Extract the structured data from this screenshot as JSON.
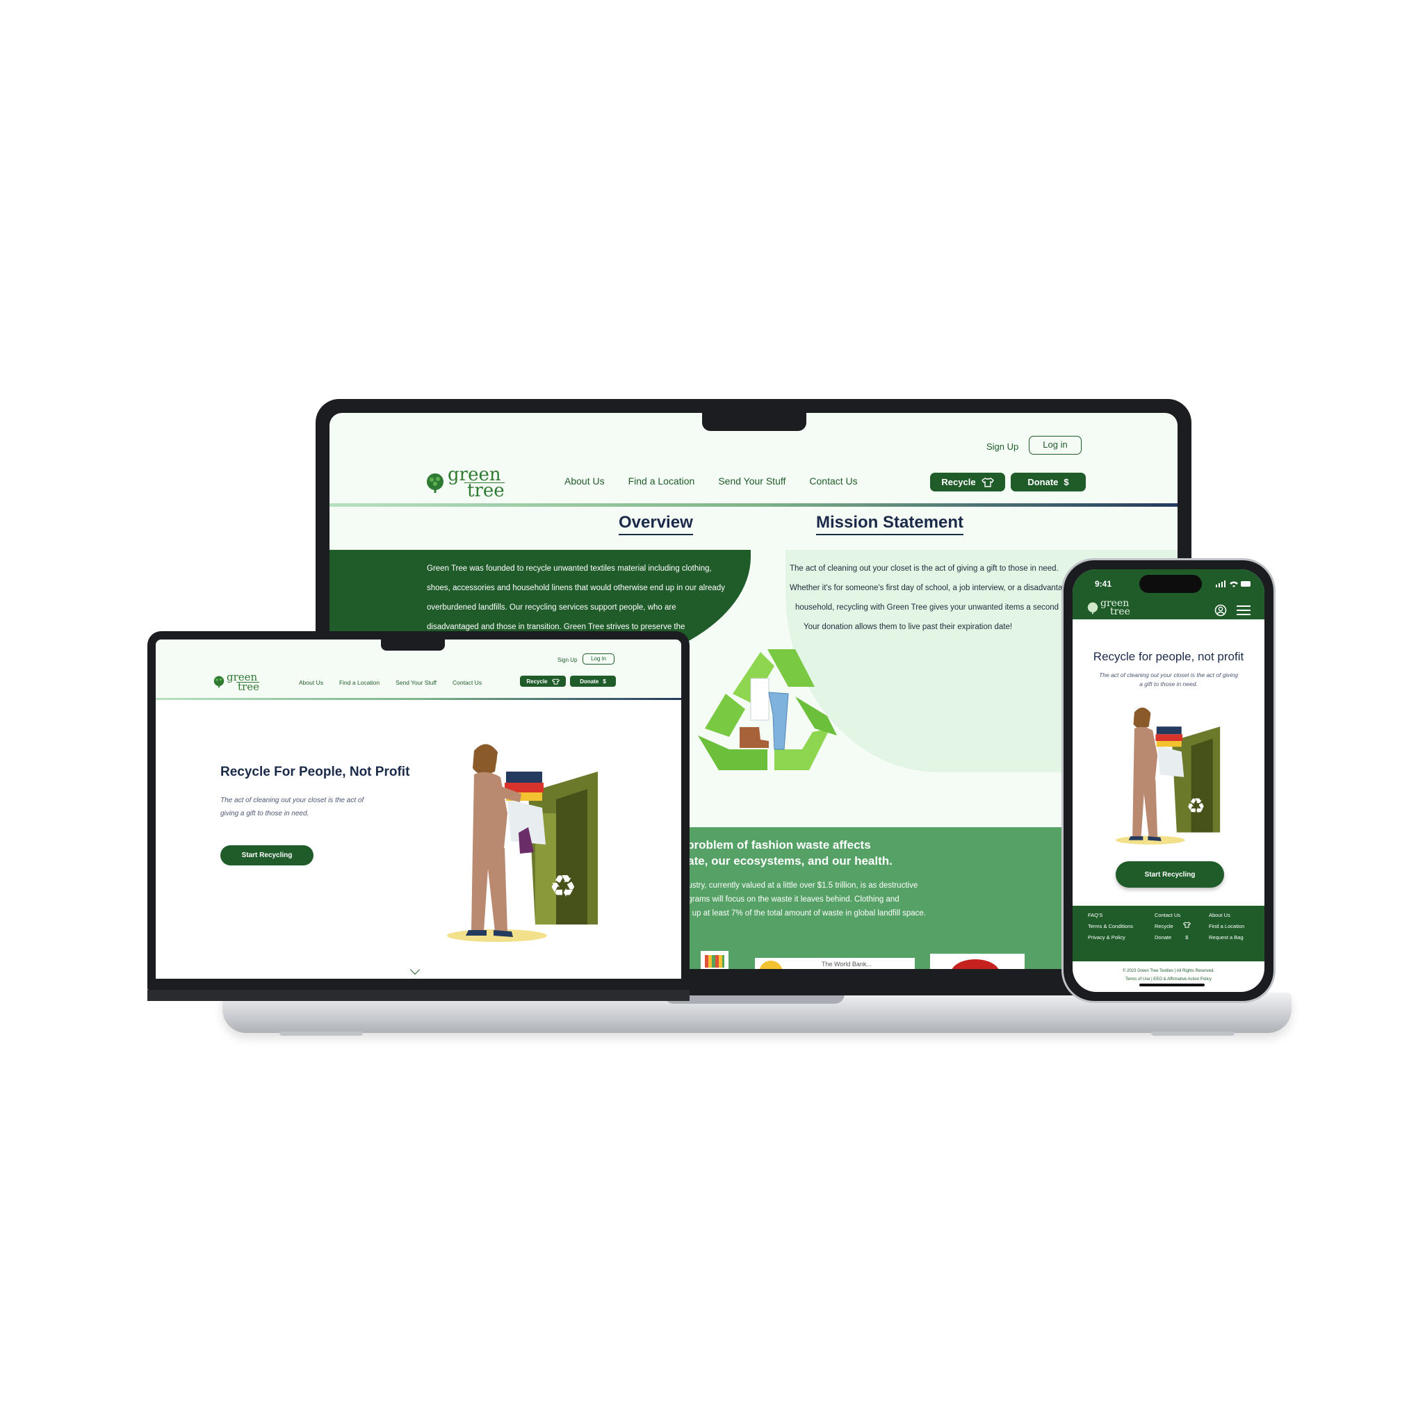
{
  "brand": {
    "line1": "green",
    "line2": "tree"
  },
  "desktop": {
    "auth": {
      "signup": "Sign Up",
      "login": "Log in"
    },
    "nav": [
      "About Us",
      "Find a Location",
      "Send Your Stuff",
      "Contact Us"
    ],
    "recycle_button": "Recycle",
    "donate_button": "Donate",
    "donate_symbol": "$",
    "overview_heading": "Overview",
    "mission_heading": "Mission Statement",
    "overview_lines": [
      "Green Tree was founded to recycle unwanted textiles material including clothing,",
      "shoes, accessories and household linens that would otherwise end up in our already",
      "overburdened landfills. Our recycling services support people, who are",
      "disadvantaged and those in transition. Green Tree strives to preserve the"
    ],
    "mission_lines": [
      "The act of cleaning out your closet is the act of giving a gift to those in need.",
      "Whether it's for someone's first day of school, a job interview, or a disadvanta",
      "household, recycling with Green Tree gives your unwanted items a second",
      "Your donation allows them to live past their expiration date!"
    ],
    "fashion_heading_lines": [
      "e problem of fashion waste affects",
      "mate, our ecosystems, and our health."
    ],
    "fashion_lines": [
      "industry, currently valued at a little over $1.5 trillion, is as destructive",
      "diagrams will focus on the waste it leaves behind. Clothing and",
      "ake up at least 7% of the total amount of waste in global landfill space."
    ],
    "card_caption": "The World Bank..."
  },
  "laptop": {
    "auth": {
      "signup": "Sign Up",
      "login": "Log in"
    },
    "nav": [
      "About Us",
      "Find a Location",
      "Send Your Stuff",
      "Contact Us"
    ],
    "recycle_button": "Recycle",
    "donate_button": "Donate",
    "donate_symbol": "$",
    "hero_title": "Recycle For People, Not Profit",
    "hero_sub_lines": [
      "The act of cleaning out your closet is the act of",
      "giving a gift to those in need."
    ],
    "cta": "Start Recycling"
  },
  "phone": {
    "time": "9:41",
    "hero_title": "Recycle for people, not profit",
    "hero_sub_lines": [
      "The act of cleaning out your closet is the act of giving",
      "a gift to those in need."
    ],
    "cta": "Start Recycling",
    "footer_col1": [
      "FAQ'S",
      "Terms & Conditions",
      "Privacy & Policy"
    ],
    "footer_col2": [
      "Contact Us",
      "Recycle",
      "Donate"
    ],
    "footer_col3": [
      "About Us",
      "Find a Location",
      "Request a Bag"
    ],
    "copyright": "© 2023 Green Tree Textiles | All Rights Reserved.",
    "legal": "Terms of Use | EEO & Affirmative Action Policy",
    "donate_symbol": "$"
  },
  "colors": {
    "primary": "#1f5c2a",
    "accent": "#55a166",
    "light": "#e3f5e5",
    "navy": "#1c2a4a",
    "recycle": "#7ac943"
  },
  "icons": [
    "tree-logo-icon",
    "shirt-icon",
    "dollar-icon",
    "recycle-icon",
    "user-circle-icon",
    "menu-icon",
    "chevron-down-icon"
  ]
}
